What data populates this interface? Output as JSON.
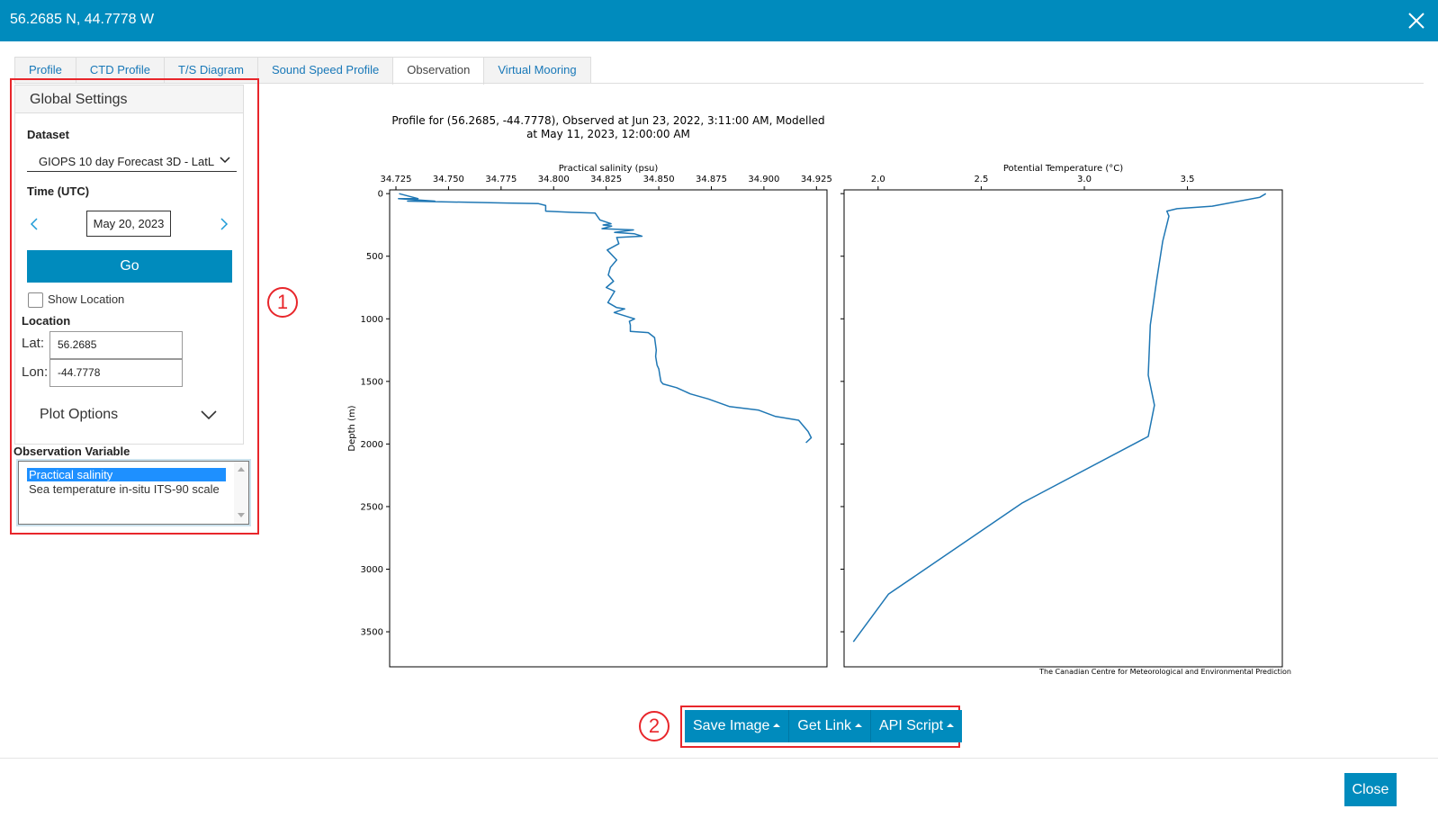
{
  "header": {
    "title": "56.2685 N, 44.7778 W"
  },
  "tabs": [
    {
      "label": "Profile"
    },
    {
      "label": "CTD Profile"
    },
    {
      "label": "T/S Diagram"
    },
    {
      "label": "Sound Speed Profile"
    },
    {
      "label": "Observation"
    },
    {
      "label": "Virtual Mooring"
    }
  ],
  "active_tab": "Observation",
  "settings": {
    "title": "Global Settings",
    "dataset_label": "Dataset",
    "dataset_value": "GIOPS 10 day Forecast 3D - LatL",
    "time_label": "Time (UTC)",
    "date_value": "May 20, 2023",
    "go_label": "Go",
    "show_location_label": "Show Location",
    "location_label": "Location",
    "lat_label": "Lat:",
    "lat_value": "56.2685",
    "lon_label": "Lon:",
    "lon_value": "-44.7778",
    "plot_options_label": "Plot Options"
  },
  "observation": {
    "label": "Observation Variable",
    "options": [
      "Practical salinity",
      "Sea temperature in-situ ITS-90 scale"
    ],
    "selected": "Practical salinity"
  },
  "annotations": [
    "1",
    "2"
  ],
  "buttons": {
    "save_image": "Save Image",
    "get_link": "Get Link",
    "api_script": "API Script",
    "close": "Close"
  },
  "colors": {
    "accent": "#008bbd",
    "annotation": "#e8262b",
    "line": "#1f77b4"
  },
  "chart_data": [
    {
      "type": "line",
      "title": "Profile for (56.2685, -44.7778), Observed at Jun 23, 2022, 3:11:00 AM, Modelled at May 11, 2023, 12:00:00 AM",
      "title_lines": [
        "Profile for (56.2685, -44.7778), Observed at Jun 23, 2022, 3:11:00 AM, Modelled",
        "at May 11, 2023, 12:00:00 AM"
      ],
      "xlabel": "Practical salinity (psu)",
      "ylabel": "Depth (m)",
      "xlim": [
        34.722,
        34.93
      ],
      "ylim": [
        3780,
        -30
      ],
      "xticks": [
        "34.725",
        "34.750",
        "34.775",
        "34.800",
        "34.825",
        "34.850",
        "34.875",
        "34.900",
        "34.925"
      ],
      "xtick_values": [
        34.725,
        34.75,
        34.775,
        34.8,
        34.825,
        34.85,
        34.875,
        34.9,
        34.925
      ],
      "yticks": [
        "0",
        "500",
        "1000",
        "1500",
        "2000",
        "2500",
        "3000",
        "3500"
      ],
      "ytick_values": [
        0,
        500,
        1000,
        1500,
        2000,
        2500,
        3000,
        3500
      ],
      "series": [
        {
          "x": [
            34.7265,
            34.7355,
            34.7262,
            34.7435,
            34.7305,
            34.7775,
            34.7928,
            34.7962,
            34.7962,
            34.809,
            34.8197,
            34.822,
            34.8273,
            34.8235,
            34.8276,
            34.823,
            34.838,
            34.829,
            34.8383,
            34.842,
            34.83,
            34.831,
            34.8255,
            34.83,
            34.827,
            34.826,
            34.8285,
            34.825,
            34.829,
            34.8258,
            34.83,
            34.8338,
            34.8288,
            34.8385,
            34.836,
            34.8365,
            34.8365,
            34.845,
            34.848,
            34.8488,
            34.8485,
            34.8492,
            34.85,
            34.8505,
            34.851,
            34.852,
            34.8585,
            34.865,
            34.8735,
            34.8835,
            34.8975,
            34.9055,
            34.9165,
            34.921,
            34.9225,
            34.92
          ],
          "y": [
            0,
            40,
            40,
            60,
            60,
            75,
            80,
            95,
            140,
            150,
            155,
            210,
            240,
            250,
            260,
            280,
            290,
            310,
            320,
            340,
            350,
            400,
            450,
            530,
            590,
            650,
            700,
            750,
            780,
            870,
            910,
            920,
            950,
            1000,
            1020,
            1050,
            1100,
            1110,
            1150,
            1250,
            1300,
            1370,
            1400,
            1450,
            1500,
            1520,
            1550,
            1600,
            1640,
            1700,
            1730,
            1780,
            1810,
            1900,
            1950,
            1990
          ]
        }
      ]
    },
    {
      "type": "line",
      "title": "",
      "xlabel": "Potential Temperature (°C)",
      "ylabel": "",
      "xlim": [
        1.835,
        3.96
      ],
      "ylim": [
        3780,
        -30
      ],
      "xticks": [
        "2.0",
        "2.5",
        "3.0",
        "3.5"
      ],
      "xtick_values": [
        2.0,
        2.5,
        3.0,
        3.5
      ],
      "yticks": [],
      "annotation": "The Canadian Centre for Meteorological and Environmental Prediction",
      "series": [
        {
          "x": [
            3.88,
            3.85,
            3.62,
            3.45,
            3.4,
            3.41,
            3.38,
            3.35,
            3.32,
            3.31,
            3.34,
            3.31,
            2.7,
            2.05,
            1.88
          ],
          "y": [
            0,
            30,
            100,
            120,
            140,
            180,
            380,
            700,
            1050,
            1450,
            1690,
            1940,
            2470,
            3200,
            3580
          ]
        }
      ]
    }
  ]
}
